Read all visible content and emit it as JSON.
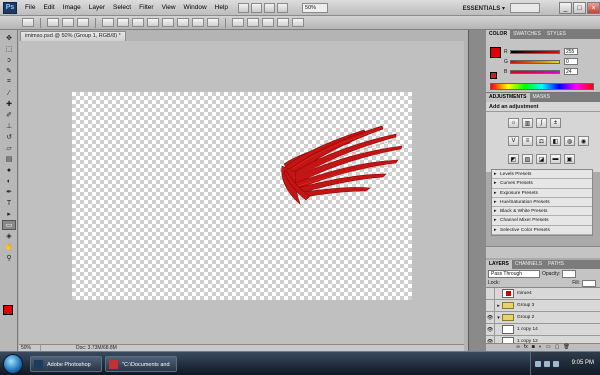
{
  "menubar": {
    "logo": "Ps",
    "items": [
      "File",
      "Edit",
      "Image",
      "Layer",
      "Select",
      "Filter",
      "View",
      "Window",
      "Help"
    ],
    "zoom": "50%",
    "workspace": "ESSENTIALS ▾",
    "minimize": "_",
    "maximize": "□",
    "close": "×"
  },
  "document": {
    "tab_title": "imimso.psd @ 50% (Group 1, RGB/8) *",
    "status_zoom": "50%",
    "status_doc": "Doc: 3.73M/68.8M"
  },
  "color_panel": {
    "tabs": [
      "COLOR",
      "SWATCHES",
      "STYLES"
    ],
    "channels": [
      "R",
      "G",
      "B"
    ],
    "r": "255",
    "g": "0",
    "b": "24",
    "foreground": "#e00000"
  },
  "adjustments_panel": {
    "tabs": [
      "ADJUSTMENTS",
      "MASKS"
    ],
    "title": "Add an adjustment",
    "presets": [
      "Levels Presets",
      "Curves Presets",
      "Exposure Presets",
      "Hue/Saturation Presets",
      "Black & White Presets",
      "Channel Mixer Presets",
      "Selective Color Presets"
    ]
  },
  "layers_panel": {
    "tabs": [
      "LAYERS",
      "CHANNELS",
      "PATHS"
    ],
    "blend_mode": "Pass Through",
    "opacity_label": "Opacity:",
    "lock_label": "Lock:",
    "fill_label": "Fill:",
    "layers": [
      {
        "name": "mirue4",
        "type": "layer",
        "visible": false
      },
      {
        "name": "Group 3",
        "type": "group",
        "visible": false
      },
      {
        "name": "Group 2",
        "type": "group",
        "visible": true
      },
      {
        "name": "1 copy 14",
        "type": "layer",
        "visible": true
      },
      {
        "name": "1 copy 12",
        "type": "layer",
        "visible": true
      }
    ]
  },
  "taskbar": {
    "apps": [
      "Adobe Photoshop CS4...",
      "\"C:\\Documents and S..."
    ],
    "clock": "9:05 PM"
  }
}
